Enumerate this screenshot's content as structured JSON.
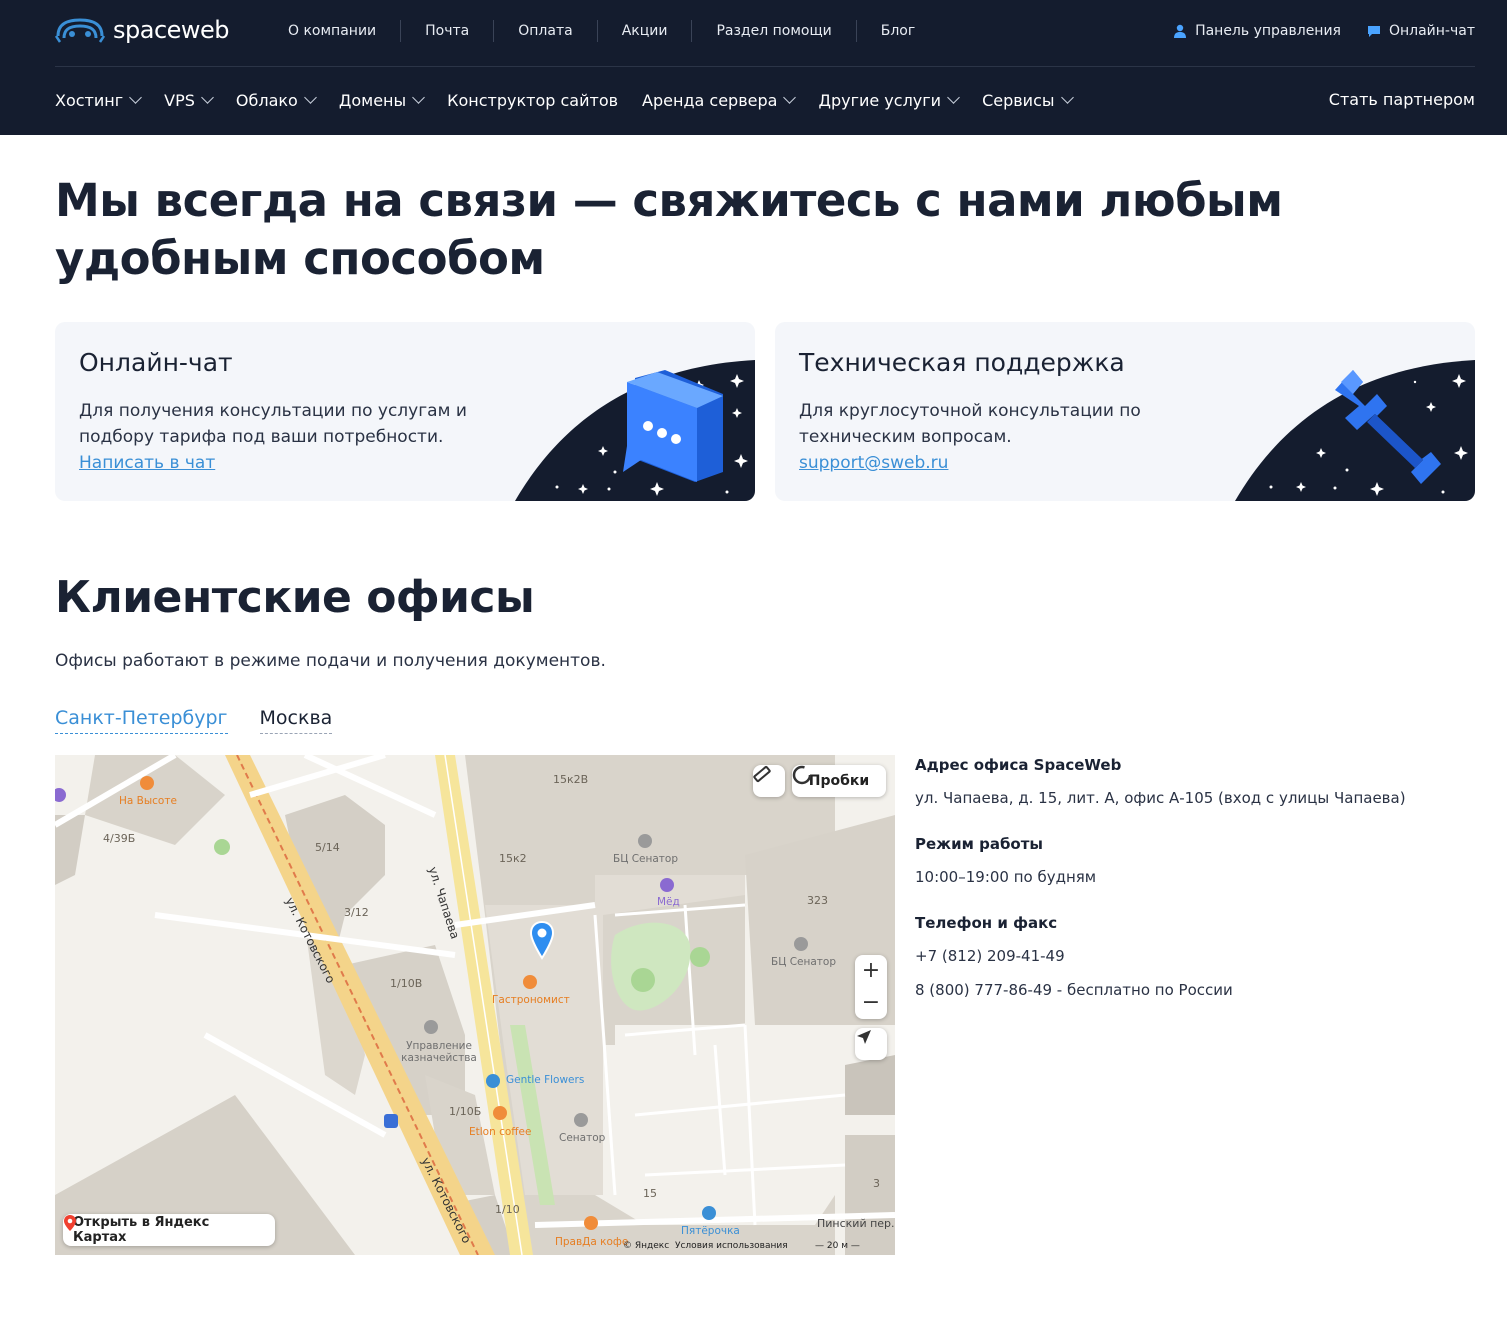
{
  "header": {
    "logo_text": "spaceweb",
    "top_nav": [
      "О компании",
      "Почта",
      "Оплата",
      "Акции",
      "Раздел помощи",
      "Блог"
    ],
    "control_panel": "Панель управления",
    "online_chat": "Онлайн-чат",
    "main_nav": [
      {
        "label": "Хостинг",
        "dropdown": true
      },
      {
        "label": "VPS",
        "dropdown": true
      },
      {
        "label": "Облако",
        "dropdown": true
      },
      {
        "label": "Домены",
        "dropdown": true
      },
      {
        "label": "Конструктор сайтов",
        "dropdown": false
      },
      {
        "label": "Аренда сервера",
        "dropdown": true
      },
      {
        "label": "Другие услуги",
        "dropdown": true
      },
      {
        "label": "Сервисы",
        "dropdown": true
      }
    ],
    "partner": "Стать партнером"
  },
  "hero": {
    "title": "Мы всегда на связи — свяжитесь с нами любым удобным способом"
  },
  "cards": [
    {
      "title": "Онлайн-чат",
      "text": "Для получения консультации по услугам и подбору тарифа под ваши потребности.",
      "link": "Написать в чат",
      "icon": "chat-bubble-icon"
    },
    {
      "title": "Техническая поддержка",
      "text": "Для круглосуточной консультации по техническим вопросам.",
      "link": "support@sweb.ru",
      "icon": "wrench-icon"
    }
  ],
  "offices": {
    "title": "Клиентские офисы",
    "subtitle": "Офисы работают в режиме подачи и получения документов.",
    "tabs": [
      {
        "label": "Санкт-Петербург",
        "active": true
      },
      {
        "label": "Москва",
        "active": false
      }
    ]
  },
  "map": {
    "labels": {
      "b15k2v": "15к2В",
      "b15k2": "15к2",
      "b514": "5/14",
      "b312": "3/12",
      "b110v": "1/10В",
      "b110b": "1/10Б",
      "b110": "1/10",
      "b439b": "4/39Б",
      "b323": "323",
      "b15": "15",
      "b3": "3",
      "street_chapaeva": "ул. Чапаева",
      "street_kotovskogo1": "ул. Котовского",
      "street_kotovskogo2": "ул. Котовского",
      "pinsky": "Пинский пер."
    },
    "pois": {
      "na_vysote": "На Высоте",
      "bc_senator1": "БЦ Сенатор",
      "med": "Мёд",
      "bc_senator2": "БЦ Сенатор",
      "gastronomist": "Гастрономист",
      "upravlenie": "Управление казначейства",
      "gentle_flowers": "Gentle Flowers",
      "etlon": "Etlon coffee",
      "senator": "Сенатор",
      "pyaterochka": "Пятёрочка",
      "pravda": "ПравДа кофе"
    },
    "traffic_button": "Пробки",
    "zoom_in": "+",
    "zoom_out": "−",
    "open_button": "Открыть в Яндекс Картах",
    "copyright": "© Яндекс",
    "terms": "Условия использования",
    "scale": "20 м"
  },
  "office_info": {
    "address_label": "Адрес офиса SpaceWeb",
    "address": "ул. Чапаева, д. 15, лит. А, офис А-105 (вход с улицы Чапаева)",
    "hours_label": "Режим работы",
    "hours": "10:00–19:00 по будням",
    "phone_label": "Телефон и факс",
    "phone1": "+7 (812) 209-41-49",
    "phone2": "8 (800) 777-86-49 - бесплатно по России"
  },
  "colors": {
    "header_bg": "#141c2e",
    "accent": "#3a8fd6",
    "card_bg": "#f4f6fa"
  }
}
